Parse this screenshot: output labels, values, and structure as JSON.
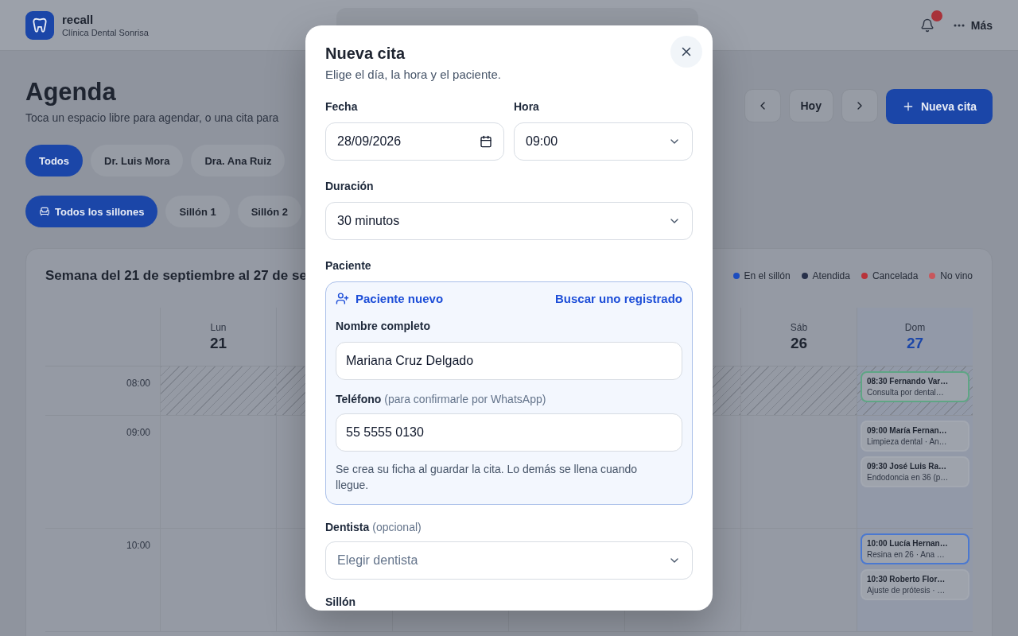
{
  "app": {
    "name": "recall",
    "clinic": "Clínica Dental Sonrisa"
  },
  "more": "Más",
  "page": {
    "title": "Agenda",
    "subtitle": "Toca un espacio libre para agendar, o una cita para",
    "today_button": "Hoy",
    "new_button": "Nueva cita"
  },
  "dentist_filters": [
    {
      "label": "Todos",
      "selected": true
    },
    {
      "label": "Dr. Luis Mora",
      "selected": false
    },
    {
      "label": "Dra. Ana Ruiz",
      "selected": false
    }
  ],
  "chair_filters": [
    {
      "label": "Todos los sillones",
      "selected": true
    },
    {
      "label": "Sillón 1",
      "selected": false
    },
    {
      "label": "Sillón 2",
      "selected": false
    }
  ],
  "calendar": {
    "week_title": "Semana del 21 de septiembre al 27 de se",
    "legend": [
      {
        "label": "En el sillón",
        "color": "#1d4fc4"
      },
      {
        "label": "Atendida",
        "color": "#27304a"
      },
      {
        "label": "Cancelada",
        "color": "#b8333a"
      },
      {
        "label": "No vino",
        "color": "#c8575c"
      }
    ],
    "days_left": [
      {
        "weekday": "Lun",
        "number": "21",
        "today": false
      }
    ],
    "days_right": [
      {
        "weekday": "Sáb",
        "number": "26",
        "today": false
      },
      {
        "weekday": "Dom",
        "number": "27",
        "today": true
      }
    ],
    "rows": [
      {
        "time": "08:00",
        "blocked": true,
        "events": [
          {
            "title": "08:30 Fernando Var…",
            "detail": "Consulta por dental…",
            "color": "#5fa585"
          }
        ]
      },
      {
        "time": "09:00",
        "blocked": false,
        "events": [
          {
            "title": "09:00 María Fernan…",
            "detail": "Limpieza dental · An…",
            "color": "#a3a8b1"
          },
          {
            "title": "09:30 José Luis Ra…",
            "detail": "Endodoncia en 36 (p…",
            "color": "#a3a8b1"
          }
        ]
      },
      {
        "time": "10:00",
        "blocked": false,
        "events": [
          {
            "title": "10:00 Lucía Hernan…",
            "detail": "Resina en 26 · Ana …",
            "color": "#4a78d0"
          },
          {
            "title": "10:30 Roberto Flor…",
            "detail": "Ajuste de prótesis · …",
            "color": "#a3a8b1"
          }
        ]
      }
    ]
  },
  "modal": {
    "title": "Nueva cita",
    "subtitle": "Elige el día, la hora y el paciente.",
    "date": {
      "label": "Fecha",
      "value": "28/09/2026"
    },
    "time": {
      "label": "Hora",
      "value": "09:00"
    },
    "duration": {
      "label": "Duración",
      "value": "30 minutos"
    },
    "patient": {
      "label": "Paciente",
      "mode": "Paciente nuevo",
      "switch_link": "Buscar uno registrado",
      "name": {
        "label": "Nombre completo",
        "value": "Mariana Cruz Delgado"
      },
      "phone": {
        "label": "Teléfono",
        "hint": "(para confirmarle por WhatsApp)",
        "value": "55 5555 0130"
      },
      "note": "Se crea su ficha al guardar la cita. Lo demás se llena cuando llegue."
    },
    "dentist": {
      "label": "Dentista",
      "hint": "(opcional)",
      "placeholder": "Elegir dentista"
    },
    "chair": {
      "label": "Sillón"
    }
  }
}
